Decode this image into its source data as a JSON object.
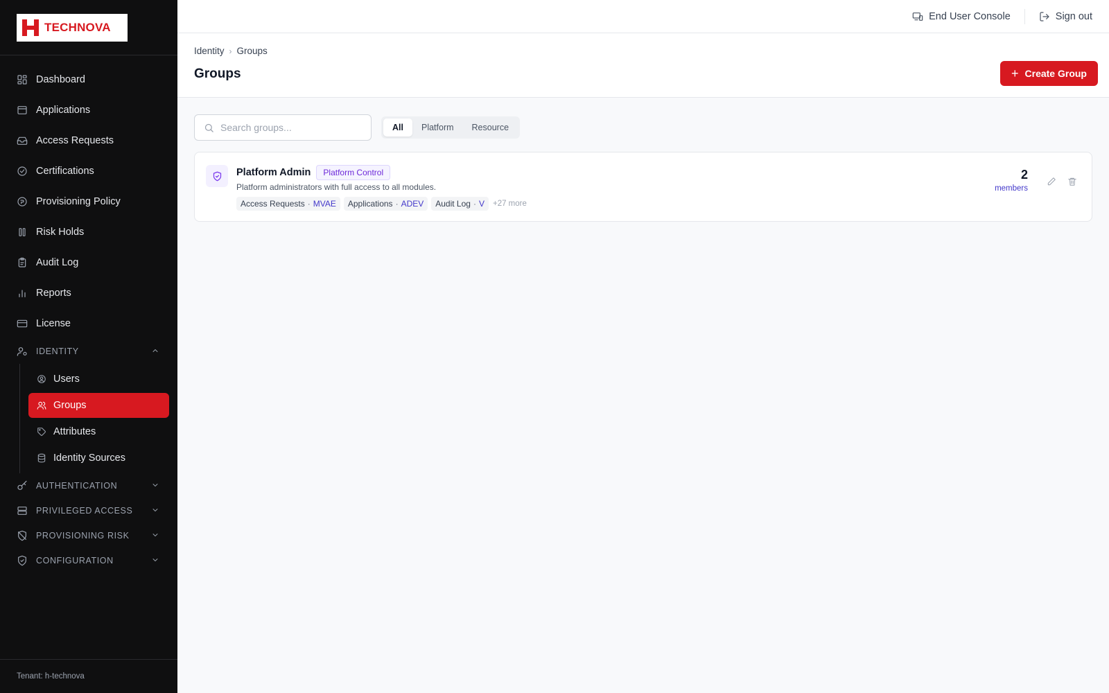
{
  "brand": {
    "name": "TECHNOVA",
    "color": "#d71920"
  },
  "sidebar": {
    "items": [
      {
        "label": "Dashboard",
        "icon": "dashboard-icon"
      },
      {
        "label": "Applications",
        "icon": "window-icon"
      },
      {
        "label": "Access Requests",
        "icon": "inbox-icon"
      },
      {
        "label": "Certifications",
        "icon": "check-circle-icon"
      },
      {
        "label": "Provisioning Policy",
        "icon": "policy-icon"
      },
      {
        "label": "Risk Holds",
        "icon": "pause-icon"
      },
      {
        "label": "Audit Log",
        "icon": "clipboard-icon"
      },
      {
        "label": "Reports",
        "icon": "bar-chart-icon"
      },
      {
        "label": "License",
        "icon": "card-icon"
      }
    ],
    "identity": {
      "label": "IDENTITY",
      "items": [
        {
          "label": "Users",
          "icon": "user-circle-icon"
        },
        {
          "label": "Groups",
          "icon": "users-icon",
          "active": true
        },
        {
          "label": "Attributes",
          "icon": "tag-icon"
        },
        {
          "label": "Identity Sources",
          "icon": "database-icon"
        }
      ]
    },
    "sections": [
      {
        "label": "AUTHENTICATION",
        "icon": "key-icon"
      },
      {
        "label": "PRIVILEGED ACCESS",
        "icon": "server-icon"
      },
      {
        "label": "PROVISIONING RISK",
        "icon": "shield-off-icon"
      },
      {
        "label": "CONFIGURATION",
        "icon": "shield-check-icon"
      }
    ],
    "tenant": "Tenant: h-technova"
  },
  "topbar": {
    "end_user_console": "End User Console",
    "sign_out": "Sign out"
  },
  "header": {
    "breadcrumb": [
      "Identity",
      "Groups"
    ],
    "title": "Groups",
    "create_button": "Create Group"
  },
  "filters": {
    "search_placeholder": "Search groups...",
    "search_value": "",
    "tabs": [
      "All",
      "Platform",
      "Resource"
    ],
    "active_tab": "All"
  },
  "groups": [
    {
      "name": "Platform Admin",
      "badge": "Platform Control",
      "description": "Platform administrators with full access to all modules.",
      "permissions": [
        {
          "module": "Access Requests",
          "code": "MVAE"
        },
        {
          "module": "Applications",
          "code": "ADEV"
        },
        {
          "module": "Audit Log",
          "code": "V"
        }
      ],
      "more": "+27 more",
      "member_count": "2",
      "member_label": "members"
    }
  ]
}
